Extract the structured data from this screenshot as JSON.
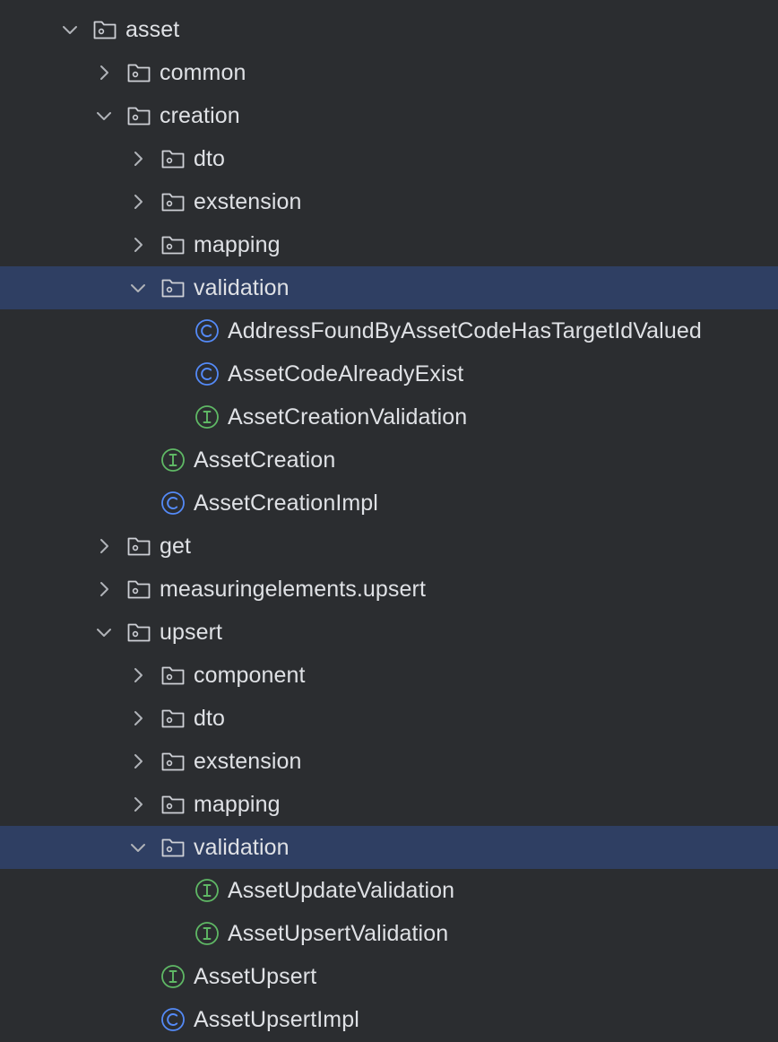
{
  "colors": {
    "background": "#2b2d30",
    "selected_row": "#2f3f63",
    "text": "#dfe1e5",
    "chevron": "#b0b3b8",
    "folder_icon": "#ced0d6",
    "class_icon": "#548af7",
    "interface_icon": "#5fb865"
  },
  "tree": [
    {
      "label": "asset",
      "kind": "folder",
      "depth": 0,
      "expanded": true,
      "selected": false
    },
    {
      "label": "common",
      "kind": "folder",
      "depth": 1,
      "expanded": false,
      "selected": false
    },
    {
      "label": "creation",
      "kind": "folder",
      "depth": 1,
      "expanded": true,
      "selected": false
    },
    {
      "label": "dto",
      "kind": "folder",
      "depth": 2,
      "expanded": false,
      "selected": false
    },
    {
      "label": "exstension",
      "kind": "folder",
      "depth": 2,
      "expanded": false,
      "selected": false
    },
    {
      "label": "mapping",
      "kind": "folder",
      "depth": 2,
      "expanded": false,
      "selected": false
    },
    {
      "label": "validation",
      "kind": "folder",
      "depth": 2,
      "expanded": true,
      "selected": true
    },
    {
      "label": "AddressFoundByAssetCodeHasTargetIdValued",
      "kind": "class",
      "depth": 3,
      "selected": false
    },
    {
      "label": "AssetCodeAlreadyExist",
      "kind": "class",
      "depth": 3,
      "selected": false
    },
    {
      "label": "AssetCreationValidation",
      "kind": "interface",
      "depth": 3,
      "selected": false
    },
    {
      "label": "AssetCreation",
      "kind": "interface",
      "depth": 2,
      "selected": false
    },
    {
      "label": "AssetCreationImpl",
      "kind": "class",
      "depth": 2,
      "selected": false
    },
    {
      "label": "get",
      "kind": "folder",
      "depth": 1,
      "expanded": false,
      "selected": false
    },
    {
      "label": "measuringelements.upsert",
      "kind": "folder",
      "depth": 1,
      "expanded": false,
      "selected": false
    },
    {
      "label": "upsert",
      "kind": "folder",
      "depth": 1,
      "expanded": true,
      "selected": false
    },
    {
      "label": "component",
      "kind": "folder",
      "depth": 2,
      "expanded": false,
      "selected": false
    },
    {
      "label": "dto",
      "kind": "folder",
      "depth": 2,
      "expanded": false,
      "selected": false
    },
    {
      "label": "exstension",
      "kind": "folder",
      "depth": 2,
      "expanded": false,
      "selected": false
    },
    {
      "label": "mapping",
      "kind": "folder",
      "depth": 2,
      "expanded": false,
      "selected": false
    },
    {
      "label": "validation",
      "kind": "folder",
      "depth": 2,
      "expanded": true,
      "selected": true
    },
    {
      "label": "AssetUpdateValidation",
      "kind": "interface",
      "depth": 3,
      "selected": false
    },
    {
      "label": "AssetUpsertValidation",
      "kind": "interface",
      "depth": 3,
      "selected": false
    },
    {
      "label": "AssetUpsert",
      "kind": "interface",
      "depth": 2,
      "selected": false
    },
    {
      "label": "AssetUpsertImpl",
      "kind": "class",
      "depth": 2,
      "selected": false
    }
  ]
}
